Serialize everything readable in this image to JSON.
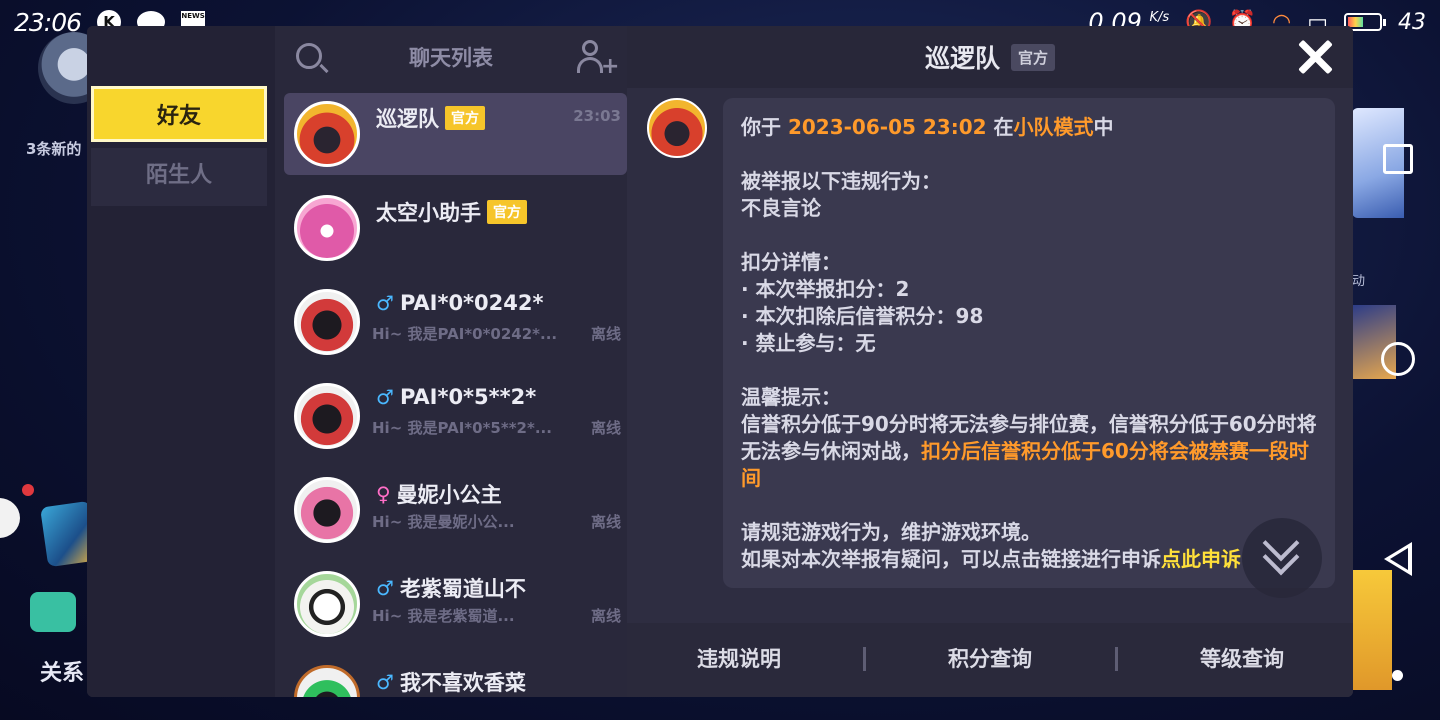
{
  "status_bar": {
    "time": "23:06",
    "k_icon": "K",
    "news_icon": "NEWS",
    "net_speed": "0.09",
    "net_speed_unit": "K/s",
    "battery": "43",
    "battery_level": 0.43
  },
  "background": {
    "notice": "3条新的",
    "relation_label": "关系",
    "activity": "动"
  },
  "tabs": [
    {
      "label": "好友",
      "selected": true
    },
    {
      "label": "陌生人",
      "selected": false
    }
  ],
  "chat_list": {
    "title": "聊天列表",
    "items": [
      {
        "name": "巡逻队",
        "badge": "官方",
        "time": "23:03",
        "preview": "",
        "status": "",
        "gender": "",
        "avatar": "patrol-avatar"
      },
      {
        "name": "太空小助手",
        "badge": "官方",
        "time": "",
        "preview": "",
        "status": "",
        "gender": "",
        "avatar": "helper-avatar"
      },
      {
        "name": "PAI*0*0242*",
        "badge": "",
        "time": "",
        "preview": "Hi~ 我是PAI*0*0242*...",
        "status": "离线",
        "gender": "♂",
        "avatar": "astronaut-red-avatar"
      },
      {
        "name": "PAI*0*5**2*",
        "badge": "",
        "time": "",
        "preview": "Hi~ 我是PAI*0*5**2*...",
        "status": "离线",
        "gender": "♂",
        "avatar": "astronaut-red-avatar"
      },
      {
        "name": "曼妮小公主",
        "badge": "",
        "time": "",
        "preview": "Hi~ 我是曼妮小公...",
        "status": "离线",
        "gender": "♀",
        "avatar": "astronaut-pink-avatar"
      },
      {
        "name": "老紫蜀道山不",
        "badge": "",
        "time": "",
        "preview": "Hi~ 我是老紫蜀道...",
        "status": "离线",
        "gender": "♂",
        "avatar": "cartoon-avatar"
      },
      {
        "name": "我不喜欢香菜",
        "badge": "",
        "time": "",
        "preview": "",
        "status": "",
        "gender": "♂",
        "avatar": "astronaut-green-avatar"
      }
    ]
  },
  "chat": {
    "title": "巡逻队",
    "badge": "官方",
    "message": {
      "line1_prefix": "你于 ",
      "line1_date": "2023-06-05 23:02",
      "line1_mid": " 在",
      "line1_mode": "小队模式",
      "line1_suffix": "中",
      "reported_label": "被举报以下违规行为：",
      "violation": "不良言论",
      "deduction_title": "扣分详情：",
      "deduction_items": [
        "· 本次举报扣分：2",
        "· 本次扣除后信誉积分：98",
        "· 禁止参与：无"
      ],
      "tip_title": "温馨提示：",
      "tip_text": "信誉积分低于90分时将无法参与排位赛，信誉积分低于60分时将无法参与休闲对战，",
      "tip_warning": "扣分后信誉积分低于60分将会被禁赛一段时间",
      "closing1": "请规范游戏行为，维护游戏环境。",
      "closing2": "如果对本次举报有疑问，可以点击链接进行申诉",
      "appeal_link": "点此申诉"
    }
  },
  "bottom_bar": {
    "buttons": [
      "违规说明",
      "积分查询",
      "等级查询"
    ]
  }
}
